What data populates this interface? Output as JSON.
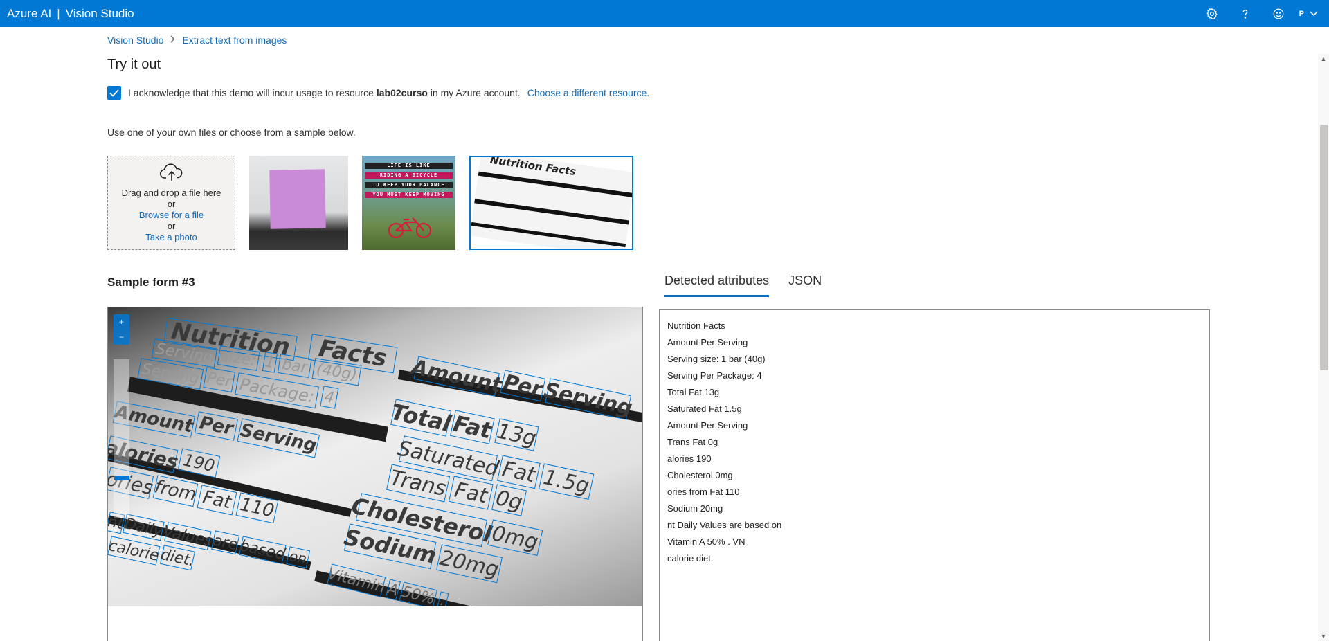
{
  "topbar": {
    "brand": "Azure AI",
    "separator": "|",
    "app_name": "Vision Studio",
    "account_initial": "P"
  },
  "breadcrumb": {
    "root": "Vision Studio",
    "current": "Extract text from images"
  },
  "page_title": "Try it out",
  "acknowledgement": {
    "text_before": "I acknowledge that this demo will incur usage to resource",
    "resource": "lab02curso",
    "text_after": "in my Azure account.",
    "link": "Choose a different resource.",
    "checked": true
  },
  "use_files_text": "Use one of your own files or choose from a sample below.",
  "upload": {
    "drag_text": "Drag and drop a file here",
    "or1": "or",
    "browse": "Browse for a file",
    "or2": "or",
    "take_photo": "Take a photo"
  },
  "samples": {
    "thumb2_lines": [
      "LIFE IS LIKE",
      "RIDING A BICYCLE",
      "TO KEEP YOUR BALANCE",
      "YOU MUST KEEP MOVING"
    ],
    "thumb3_title": "Nutrition Facts",
    "selected_index": 3
  },
  "sample_title": "Sample form #3",
  "tabs": [
    {
      "label": "Detected attributes",
      "active": true
    },
    {
      "label": "JSON",
      "active": false
    }
  ],
  "ocr_words": {
    "nutrition": "Nutrition",
    "facts": "Facts",
    "serving1": "Serving",
    "size": "size:",
    "one": "1",
    "bar": "bar",
    "forty": "(40g)",
    "serving2": "Serving",
    "per1": "Per",
    "package": "Package:",
    "four": "4",
    "amount1": "Amount",
    "per2": "Per",
    "serving3": "Serving",
    "alories": "alories",
    "n190": "190",
    "ories": "ories",
    "from": "from",
    "fat1": "Fat",
    "n110": "110",
    "nt": "nt",
    "daily": "Daily",
    "values": "Values",
    "are": "are",
    "based": "based",
    "on": "on",
    "calorie": "calorie",
    "diet": "diet.",
    "amount2": "Amount",
    "per3": "Per",
    "serving4": "Serving",
    "total": "Total",
    "fat2": "Fat",
    "n13g": "13g",
    "saturated": "Saturated",
    "fat3": "Fat",
    "n15g": "1.5g",
    "trans": "Trans",
    "fat4": "Fat",
    "n0g": "0g",
    "cholesterol": "Cholesterol",
    "n0mg": "0mg",
    "sodium": "Sodium",
    "n20mg": "20mg",
    "vitamin": "Vitamin",
    "a": "A",
    "n50": "50%",
    "dot": "."
  },
  "detected_lines": [
    "Nutrition Facts",
    "Amount Per Serving",
    "Serving size: 1 bar (40g)",
    "Serving Per Package: 4",
    "Total Fat 13g",
    "Saturated Fat 1.5g",
    "Amount Per Serving",
    "Trans Fat 0g",
    "alories 190",
    "Cholesterol 0mg",
    "ories from Fat 110",
    "Sodium 20mg",
    "nt Daily Values are based on",
    "Vitamin A 50% . VN",
    "calorie diet."
  ],
  "colors": {
    "brand_blue": "#0078d4",
    "link_blue": "#0f6cbd"
  }
}
